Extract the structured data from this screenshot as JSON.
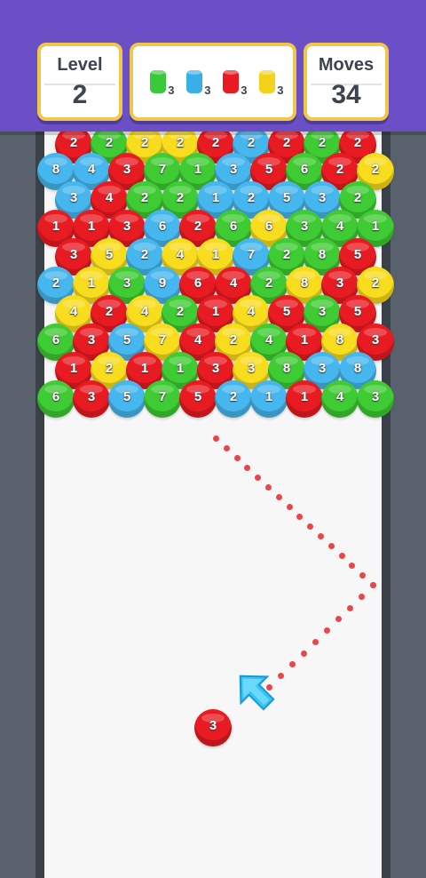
{
  "hud": {
    "level": {
      "label": "Level",
      "value": "2"
    },
    "moves": {
      "label": "Moves",
      "value": "34"
    },
    "goals": [
      {
        "color": "#39c93a",
        "count": "3",
        "icon": "green-bubble-stack-icon"
      },
      {
        "color": "#3aaee8",
        "count": "3",
        "icon": "blue-bubble-stack-icon"
      },
      {
        "color": "#e81b22",
        "count": "3",
        "icon": "red-bubble-stack-icon"
      },
      {
        "color": "#f4d21c",
        "count": "3",
        "icon": "yellow-bubble-stack-icon"
      }
    ]
  },
  "colors": {
    "r": "#e81b22",
    "g": "#3ecb33",
    "b": "#46b7ee",
    "y": "#f8dc1e"
  },
  "grid": {
    "rows": [
      [
        [
          "r",
          "2"
        ],
        [
          "g",
          "2"
        ],
        [
          "y",
          "2"
        ],
        [
          "y",
          "2"
        ],
        [
          "r",
          "2"
        ],
        [
          "b",
          "2"
        ],
        [
          "r",
          "2"
        ],
        [
          "g",
          "2"
        ],
        [
          "r",
          "2"
        ]
      ],
      [
        [
          "b",
          "8"
        ],
        [
          "b",
          "4"
        ],
        [
          "r",
          "3"
        ],
        [
          "g",
          "7"
        ],
        [
          "g",
          "1"
        ],
        [
          "b",
          "3"
        ],
        [
          "r",
          "5"
        ],
        [
          "g",
          "6"
        ],
        [
          "r",
          "2"
        ],
        [
          "y",
          "2"
        ]
      ],
      [
        [
          "b",
          "3"
        ],
        [
          "r",
          "4"
        ],
        [
          "g",
          "2"
        ],
        [
          "g",
          "2"
        ],
        [
          "b",
          "1"
        ],
        [
          "b",
          "2"
        ],
        [
          "b",
          "5"
        ],
        [
          "b",
          "3"
        ],
        [
          "g",
          "2"
        ]
      ],
      [
        [
          "r",
          "1"
        ],
        [
          "r",
          "1"
        ],
        [
          "r",
          "3"
        ],
        [
          "b",
          "6"
        ],
        [
          "r",
          "2"
        ],
        [
          "g",
          "6"
        ],
        [
          "y",
          "6"
        ],
        [
          "g",
          "3"
        ],
        [
          "g",
          "4"
        ],
        [
          "g",
          "1"
        ]
      ],
      [
        [
          "r",
          "3"
        ],
        [
          "y",
          "5"
        ],
        [
          "b",
          "2"
        ],
        [
          "y",
          "4"
        ],
        [
          "y",
          "1"
        ],
        [
          "b",
          "7"
        ],
        [
          "g",
          "2"
        ],
        [
          "g",
          "8"
        ],
        [
          "r",
          "5"
        ]
      ],
      [
        [
          "b",
          "2"
        ],
        [
          "y",
          "1"
        ],
        [
          "g",
          "3"
        ],
        [
          "b",
          "9"
        ],
        [
          "r",
          "6"
        ],
        [
          "r",
          "4"
        ],
        [
          "g",
          "2"
        ],
        [
          "y",
          "8"
        ],
        [
          "r",
          "3"
        ],
        [
          "y",
          "2"
        ]
      ],
      [
        [
          "y",
          "4"
        ],
        [
          "r",
          "2"
        ],
        [
          "y",
          "4"
        ],
        [
          "g",
          "2"
        ],
        [
          "r",
          "1"
        ],
        [
          "y",
          "4"
        ],
        [
          "r",
          "5"
        ],
        [
          "g",
          "3"
        ],
        [
          "r",
          "5"
        ]
      ],
      [
        [
          "g",
          "6"
        ],
        [
          "r",
          "3"
        ],
        [
          "b",
          "5"
        ],
        [
          "y",
          "7"
        ],
        [
          "r",
          "4"
        ],
        [
          "y",
          "2"
        ],
        [
          "g",
          "4"
        ],
        [
          "r",
          "1"
        ],
        [
          "y",
          "8"
        ],
        [
          "r",
          "3"
        ]
      ],
      [
        [
          "r",
          "1"
        ],
        [
          "y",
          "2"
        ],
        [
          "r",
          "1"
        ],
        [
          "g",
          "1"
        ],
        [
          "r",
          "3"
        ],
        [
          "y",
          "3"
        ],
        [
          "g",
          "8"
        ],
        [
          "b",
          "3"
        ],
        [
          "b",
          "8"
        ]
      ],
      [
        [
          "g",
          "6"
        ],
        [
          "r",
          "3"
        ],
        [
          "b",
          "5"
        ],
        [
          "g",
          "7"
        ],
        [
          "r",
          "5"
        ],
        [
          "b",
          "2"
        ],
        [
          "b",
          "1"
        ],
        [
          "r",
          "1"
        ],
        [
          "g",
          "4"
        ],
        [
          "g",
          "3"
        ]
      ]
    ]
  },
  "shooter": {
    "color": "r",
    "value": "3"
  }
}
